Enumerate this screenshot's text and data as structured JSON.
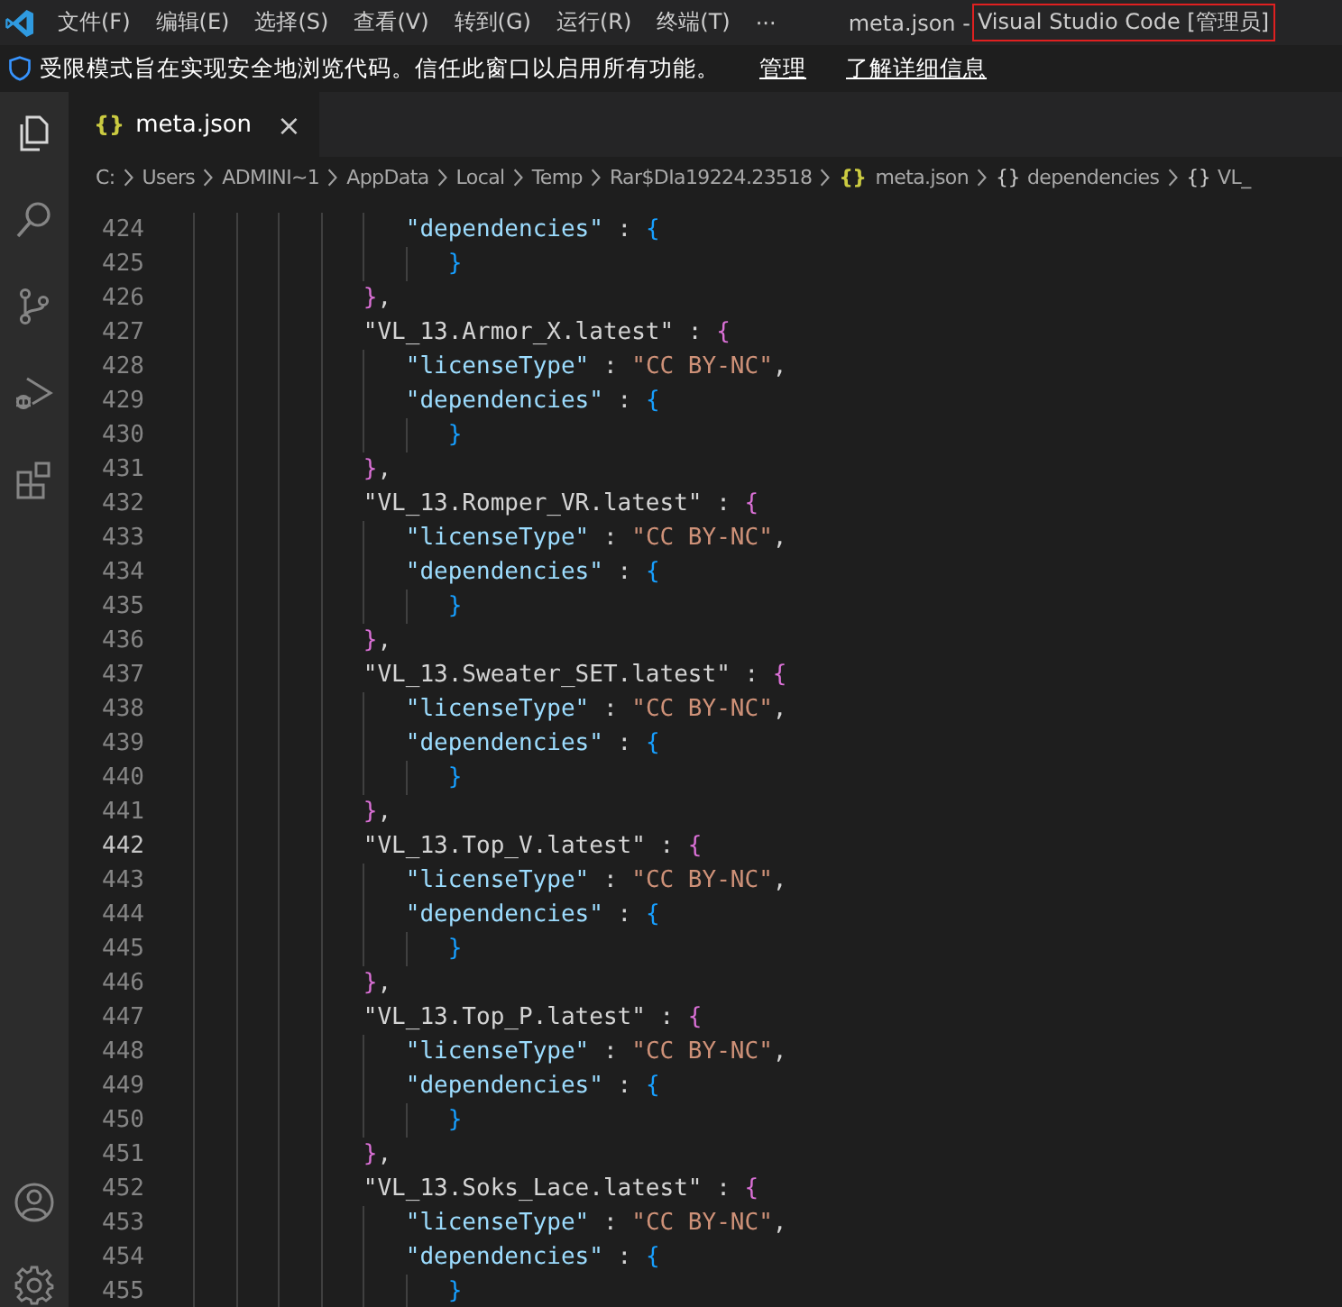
{
  "title_bar": {
    "menu": [
      "文件(F)",
      "编辑(E)",
      "选择(S)",
      "查看(V)",
      "转到(G)",
      "运行(R)",
      "终端(T)",
      "···"
    ],
    "file_title": "meta.json -",
    "app_title": "Visual Studio Code [管理员]"
  },
  "banner": {
    "message": "受限模式旨在实现安全地浏览代码。信任此窗口以启用所有功能。",
    "links": [
      "管理",
      "了解详细信息"
    ]
  },
  "tabs": [
    {
      "icon": "{}",
      "label": "meta.json",
      "selected": true,
      "close": "×"
    }
  ],
  "breadcrumb": [
    {
      "label": "C:",
      "kind": "folder"
    },
    {
      "label": "Users",
      "kind": "folder"
    },
    {
      "label": "ADMINI~1",
      "kind": "folder"
    },
    {
      "label": "AppData",
      "kind": "folder"
    },
    {
      "label": "Local",
      "kind": "folder"
    },
    {
      "label": "Temp",
      "kind": "folder"
    },
    {
      "label": "Rar$DIa19224.23518",
      "kind": "folder"
    },
    {
      "label": "meta.json",
      "kind": "file",
      "icon": "{}"
    },
    {
      "label": "dependencies",
      "kind": "object",
      "icon": "{}"
    },
    {
      "label": "VL_",
      "kind": "object",
      "icon": "{}"
    }
  ],
  "lines": [
    {
      "number": "424",
      "current": false,
      "tokens": [
        {
          "kind": "key",
          "text": "                  \"dependencies\""
        },
        {
          "kind": "punct",
          "text": " : "
        },
        {
          "kind": "brace",
          "text": "{",
          "color": "#179fff"
        }
      ]
    },
    {
      "number": "425",
      "current": false,
      "tokens": [
        {
          "kind": "brace",
          "text": "                     }",
          "color": "#179fff"
        }
      ]
    },
    {
      "number": "426",
      "current": false,
      "tokens": [
        {
          "kind": "brace",
          "text": "               }",
          "color": "#da70d6"
        },
        {
          "kind": "punct",
          "text": ","
        }
      ]
    },
    {
      "number": "427",
      "current": false,
      "tokens": [
        {
          "kind": "name",
          "text": "               \"VL_13.Armor_X.latest\""
        },
        {
          "kind": "punct",
          "text": " : "
        },
        {
          "kind": "brace",
          "text": "{",
          "color": "#da70d6"
        }
      ]
    },
    {
      "number": "428",
      "current": false,
      "tokens": [
        {
          "kind": "key",
          "text": "                  \"licenseType\""
        },
        {
          "kind": "punct",
          "text": " : "
        },
        {
          "kind": "str",
          "text": "\"CC BY-NC\""
        },
        {
          "kind": "punct",
          "text": ","
        }
      ]
    },
    {
      "number": "429",
      "current": false,
      "tokens": [
        {
          "kind": "key",
          "text": "                  \"dependencies\""
        },
        {
          "kind": "punct",
          "text": " : "
        },
        {
          "kind": "brace",
          "text": "{",
          "color": "#179fff"
        }
      ]
    },
    {
      "number": "430",
      "current": false,
      "tokens": [
        {
          "kind": "brace",
          "text": "                     }",
          "color": "#179fff"
        }
      ]
    },
    {
      "number": "431",
      "current": false,
      "tokens": [
        {
          "kind": "brace",
          "text": "               }",
          "color": "#da70d6"
        },
        {
          "kind": "punct",
          "text": ","
        }
      ]
    },
    {
      "number": "432",
      "current": false,
      "tokens": [
        {
          "kind": "name",
          "text": "               \"VL_13.Romper_VR.latest\""
        },
        {
          "kind": "punct",
          "text": " : "
        },
        {
          "kind": "brace",
          "text": "{",
          "color": "#da70d6"
        }
      ]
    },
    {
      "number": "433",
      "current": false,
      "tokens": [
        {
          "kind": "key",
          "text": "                  \"licenseType\""
        },
        {
          "kind": "punct",
          "text": " : "
        },
        {
          "kind": "str",
          "text": "\"CC BY-NC\""
        },
        {
          "kind": "punct",
          "text": ","
        }
      ]
    },
    {
      "number": "434",
      "current": false,
      "tokens": [
        {
          "kind": "key",
          "text": "                  \"dependencies\""
        },
        {
          "kind": "punct",
          "text": " : "
        },
        {
          "kind": "brace",
          "text": "{",
          "color": "#179fff"
        }
      ]
    },
    {
      "number": "435",
      "current": false,
      "tokens": [
        {
          "kind": "brace",
          "text": "                     }",
          "color": "#179fff"
        }
      ]
    },
    {
      "number": "436",
      "current": false,
      "tokens": [
        {
          "kind": "brace",
          "text": "               }",
          "color": "#da70d6"
        },
        {
          "kind": "punct",
          "text": ","
        }
      ]
    },
    {
      "number": "437",
      "current": false,
      "tokens": [
        {
          "kind": "name",
          "text": "               \"VL_13.Sweater_SET.latest\""
        },
        {
          "kind": "punct",
          "text": " : "
        },
        {
          "kind": "brace",
          "text": "{",
          "color": "#da70d6"
        }
      ]
    },
    {
      "number": "438",
      "current": false,
      "tokens": [
        {
          "kind": "key",
          "text": "                  \"licenseType\""
        },
        {
          "kind": "punct",
          "text": " : "
        },
        {
          "kind": "str",
          "text": "\"CC BY-NC\""
        },
        {
          "kind": "punct",
          "text": ","
        }
      ]
    },
    {
      "number": "439",
      "current": false,
      "tokens": [
        {
          "kind": "key",
          "text": "                  \"dependencies\""
        },
        {
          "kind": "punct",
          "text": " : "
        },
        {
          "kind": "brace",
          "text": "{",
          "color": "#179fff"
        }
      ]
    },
    {
      "number": "440",
      "current": false,
      "tokens": [
        {
          "kind": "brace",
          "text": "                     }",
          "color": "#179fff"
        }
      ]
    },
    {
      "number": "441",
      "current": false,
      "tokens": [
        {
          "kind": "brace",
          "text": "               }",
          "color": "#da70d6"
        },
        {
          "kind": "punct",
          "text": ","
        }
      ]
    },
    {
      "number": "442",
      "current": true,
      "tokens": [
        {
          "kind": "name",
          "text": "               \"VL_13.Top_V.latest\""
        },
        {
          "kind": "punct",
          "text": " : "
        },
        {
          "kind": "brace",
          "text": "{",
          "color": "#da70d6"
        }
      ]
    },
    {
      "number": "443",
      "current": false,
      "tokens": [
        {
          "kind": "key",
          "text": "                  \"licenseType\""
        },
        {
          "kind": "punct",
          "text": " : "
        },
        {
          "kind": "str",
          "text": "\"CC BY-NC\""
        },
        {
          "kind": "punct",
          "text": ","
        }
      ]
    },
    {
      "number": "444",
      "current": false,
      "tokens": [
        {
          "kind": "key",
          "text": "                  \"dependencies\""
        },
        {
          "kind": "punct",
          "text": " : "
        },
        {
          "kind": "brace",
          "text": "{",
          "color": "#179fff"
        }
      ]
    },
    {
      "number": "445",
      "current": false,
      "tokens": [
        {
          "kind": "brace",
          "text": "                     }",
          "color": "#179fff"
        }
      ]
    },
    {
      "number": "446",
      "current": false,
      "tokens": [
        {
          "kind": "brace",
          "text": "               }",
          "color": "#da70d6"
        },
        {
          "kind": "punct",
          "text": ","
        }
      ]
    },
    {
      "number": "447",
      "current": false,
      "tokens": [
        {
          "kind": "name",
          "text": "               \"VL_13.Top_P.latest\""
        },
        {
          "kind": "punct",
          "text": " : "
        },
        {
          "kind": "brace",
          "text": "{",
          "color": "#da70d6"
        }
      ]
    },
    {
      "number": "448",
      "current": false,
      "tokens": [
        {
          "kind": "key",
          "text": "                  \"licenseType\""
        },
        {
          "kind": "punct",
          "text": " : "
        },
        {
          "kind": "str",
          "text": "\"CC BY-NC\""
        },
        {
          "kind": "punct",
          "text": ","
        }
      ]
    },
    {
      "number": "449",
      "current": false,
      "tokens": [
        {
          "kind": "key",
          "text": "                  \"dependencies\""
        },
        {
          "kind": "punct",
          "text": " : "
        },
        {
          "kind": "brace",
          "text": "{",
          "color": "#179fff"
        }
      ]
    },
    {
      "number": "450",
      "current": false,
      "tokens": [
        {
          "kind": "brace",
          "text": "                     }",
          "color": "#179fff"
        }
      ]
    },
    {
      "number": "451",
      "current": false,
      "tokens": [
        {
          "kind": "brace",
          "text": "               }",
          "color": "#da70d6"
        },
        {
          "kind": "punct",
          "text": ","
        }
      ]
    },
    {
      "number": "452",
      "current": false,
      "tokens": [
        {
          "kind": "name",
          "text": "               \"VL_13.Soks_Lace.latest\""
        },
        {
          "kind": "punct",
          "text": " : "
        },
        {
          "kind": "brace",
          "text": "{",
          "color": "#da70d6"
        }
      ]
    },
    {
      "number": "453",
      "current": false,
      "tokens": [
        {
          "kind": "key",
          "text": "                  \"licenseType\""
        },
        {
          "kind": "punct",
          "text": " : "
        },
        {
          "kind": "str",
          "text": "\"CC BY-NC\""
        },
        {
          "kind": "punct",
          "text": ","
        }
      ]
    },
    {
      "number": "454",
      "current": false,
      "tokens": [
        {
          "kind": "key",
          "text": "                  \"dependencies\""
        },
        {
          "kind": "punct",
          "text": " : "
        },
        {
          "kind": "brace",
          "text": "{",
          "color": "#179fff"
        }
      ]
    },
    {
      "number": "455",
      "current": false,
      "tokens": [
        {
          "kind": "brace",
          "text": "                     }",
          "color": "#179fff"
        }
      ]
    }
  ]
}
